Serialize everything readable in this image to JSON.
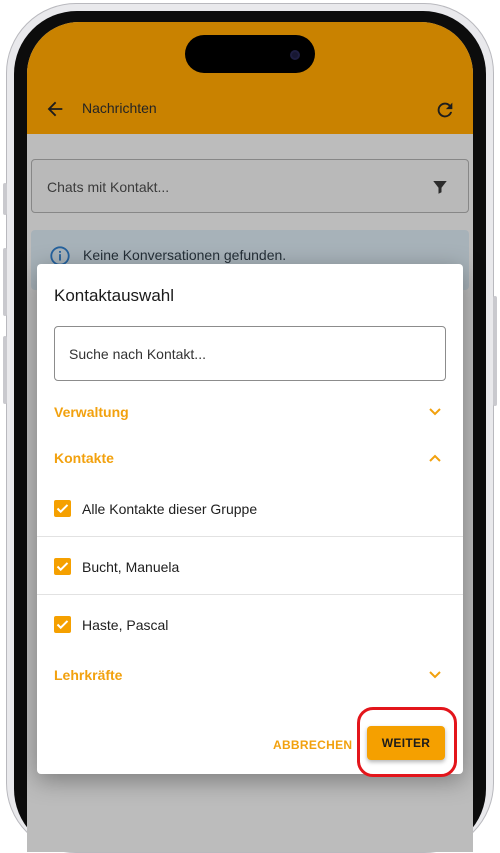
{
  "app_bar": {
    "title": "Nachrichten",
    "color": "#e59400"
  },
  "chat_filter": {
    "label": "Chats mit Kontakt..."
  },
  "info": {
    "text": "Keine Konversationen gefunden."
  },
  "dialog": {
    "title": "Kontaktauswahl",
    "search_placeholder": "Suche nach Kontakt...",
    "sections": [
      {
        "label": "Verwaltung",
        "expanded": false
      },
      {
        "label": "Kontakte",
        "expanded": true
      },
      {
        "label": "Lehrkräfte",
        "expanded": false
      }
    ],
    "contacts": [
      {
        "label": "Alle Kontakte dieser Gruppe",
        "checked": true
      },
      {
        "label": "Bucht, Manuela",
        "checked": true
      },
      {
        "label": "Haste, Pascal",
        "checked": true
      }
    ],
    "cancel_label": "ABBRECHEN",
    "next_label": "WEITER"
  },
  "colors": {
    "accent": "#f5a000",
    "highlight": "#e3151b"
  }
}
